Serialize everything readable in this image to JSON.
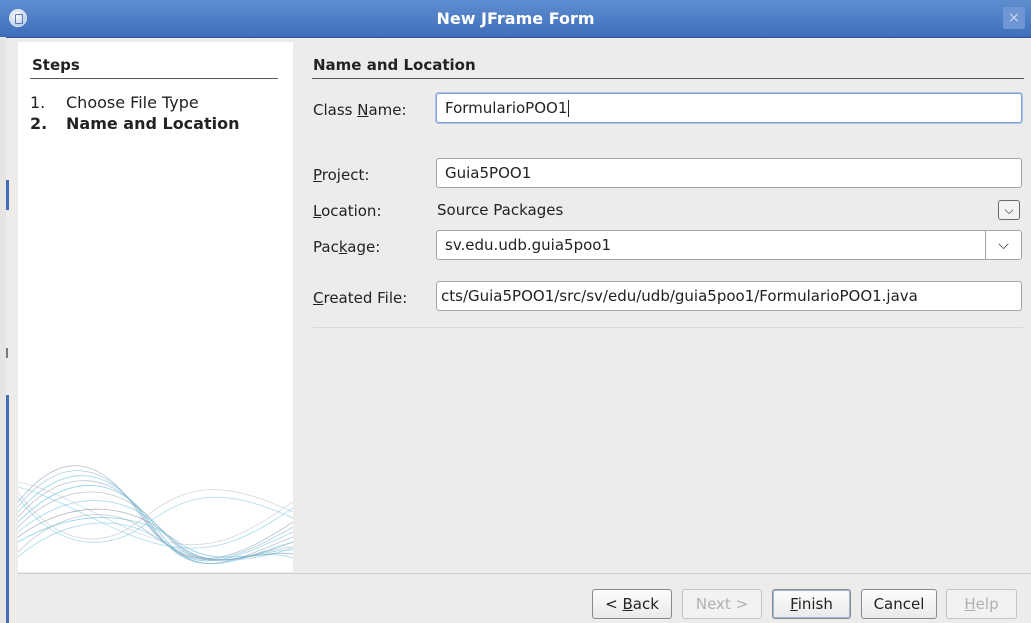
{
  "window": {
    "title": "New JFrame Form",
    "close_label": "×"
  },
  "steps": {
    "title": "Steps",
    "items": [
      {
        "num": "1.",
        "label": "Choose File Type"
      },
      {
        "num": "2.",
        "label": "Name and Location"
      }
    ]
  },
  "panel": {
    "title": "Name and Location"
  },
  "form": {
    "class_name": {
      "label_pre": "Class ",
      "label_mn": "N",
      "label_post": "ame:",
      "value": "FormularioPOO1"
    },
    "project": {
      "label_mn": "P",
      "label_post": "roject:",
      "value": "Guia5POO1"
    },
    "location": {
      "label_mn": "L",
      "label_post": "ocation:",
      "value": "Source Packages",
      "dropdown_icon": "chevron-down-icon"
    },
    "package": {
      "label_pre": "Pac",
      "label_mn": "k",
      "label_post": "age:",
      "value": "sv.edu.udb.guia5poo1",
      "dropdown_icon": "chevron-down-icon"
    },
    "created_file": {
      "label_mn": "C",
      "label_post": "reated File:",
      "value": "cts/Guia5POO1/src/sv/edu/udb/guia5poo1/FormularioPOO1.java"
    }
  },
  "buttons": {
    "back": {
      "pre": "< ",
      "mn": "B",
      "post": "ack"
    },
    "next": {
      "label": "Next >"
    },
    "finish": {
      "mn": "F",
      "post": "inish"
    },
    "cancel": {
      "label": "Cancel"
    },
    "help": {
      "mn": "H",
      "post": "elp"
    }
  }
}
